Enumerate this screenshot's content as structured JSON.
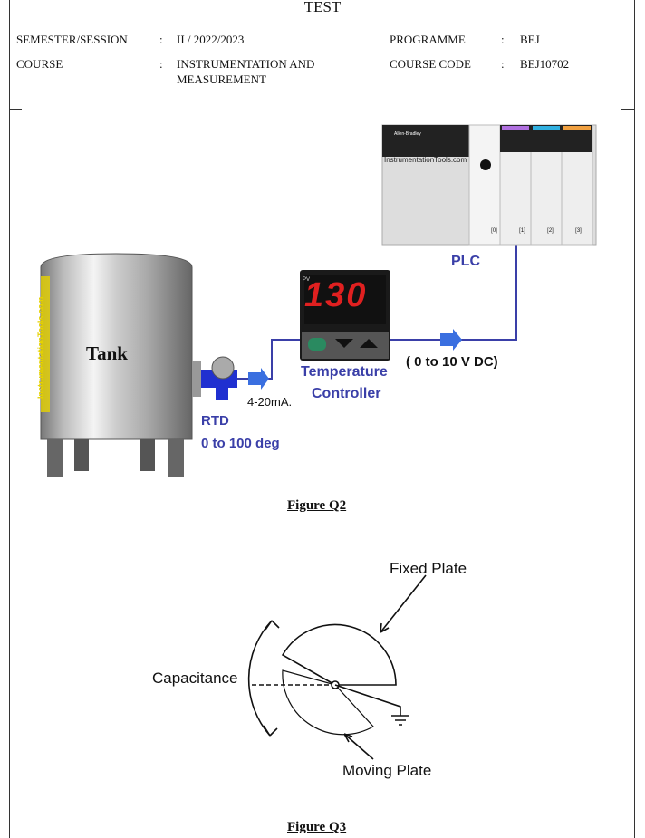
{
  "header": {
    "title": "TEST",
    "semester_label": "SEMESTER/SESSION",
    "semester_value": "II / 2022/2023",
    "programme_label": "PROGRAMME",
    "programme_value": "BEJ",
    "course_label": "COURSE",
    "course_value_line1": "INSTRUMENTATION AND",
    "course_value_line2": "MEASUREMENT",
    "course_code_label": "COURSE CODE",
    "course_code_value": "BEJ10702",
    "colon": ":"
  },
  "figure_q2": {
    "caption": "Figure Q2",
    "tank": "Tank",
    "watermark": "InstrumentationTools.com",
    "rtd": "RTD",
    "rtd_range": "0 to 100 deg",
    "current_signal": "4-20mA.",
    "controller_line1": "Temperature",
    "controller_line2": "Controller",
    "display_value": "130",
    "pv": "PV",
    "voltage": "( 0 to 10 V DC)",
    "plc": "PLC",
    "plc_brand": "Allen-Bradley",
    "plc_watermark": "InstrumentationTools.com",
    "slots": [
      "[0]",
      "[1]",
      "[2]",
      "[3]"
    ],
    "accent": "#3a3fa8"
  },
  "figure_q3": {
    "caption": "Figure Q3",
    "fixed_plate": "Fixed Plate",
    "moving_plate": "Moving Plate",
    "capacitance": "Capacitance"
  }
}
